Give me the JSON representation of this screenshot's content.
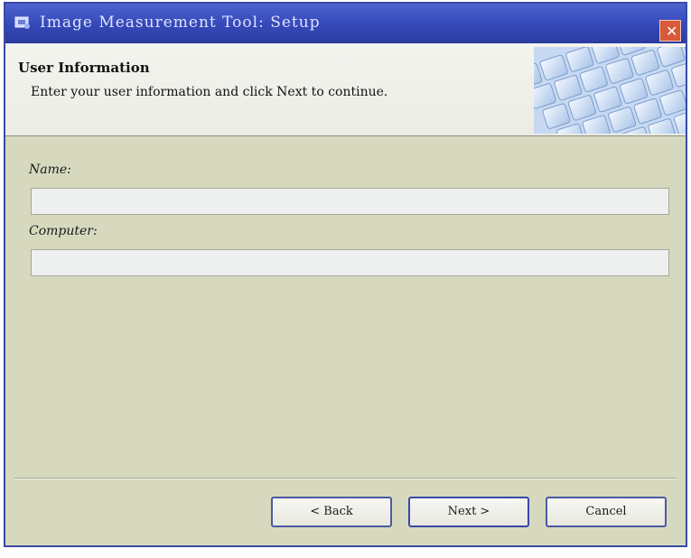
{
  "window": {
    "title": "Image Measurement Tool: Setup",
    "close_label": "✕"
  },
  "header": {
    "title": "User Information",
    "subtitle": "Enter your user information and click Next to continue."
  },
  "form": {
    "name_label": "Name:",
    "name_value": "",
    "computer_label": "Computer:",
    "computer_value": ""
  },
  "buttons": {
    "back": "< Back",
    "next": "Next >",
    "cancel": "Cancel"
  },
  "colors": {
    "titlebar": "#3448b8",
    "dialog_background": "#d7d9bf",
    "header_background": "#f4f4ef",
    "close_button": "#d85a3a"
  },
  "icons": {
    "app_icon": "setup-app-icon",
    "header_graphic": "keyboard-keys-graphic"
  }
}
